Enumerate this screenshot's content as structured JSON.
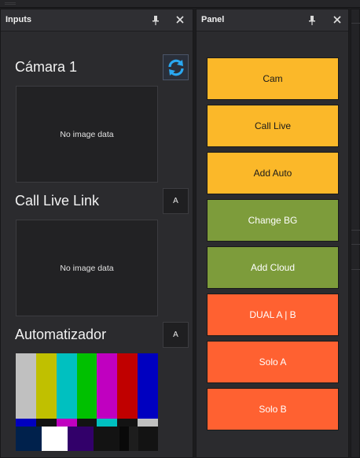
{
  "inputs_dock": {
    "title": "Inputs",
    "sections": [
      {
        "title": "Cámara 1",
        "preview_text": "No image data",
        "action": "refresh-icon"
      },
      {
        "title": "Call Live Link",
        "preview_text": "No image data",
        "action_label": "A"
      },
      {
        "title": "Automatizador",
        "action_label": "A"
      }
    ],
    "test_pattern_colors": {
      "top": [
        "#c0c0c0",
        "#c0c000",
        "#00c0c0",
        "#00c000",
        "#c000c0",
        "#c00000",
        "#0000c0"
      ],
      "middle": [
        "#0000c0",
        "#131313",
        "#c000c0",
        "#131313",
        "#00c0c0",
        "#131313",
        "#c0c0c0"
      ],
      "bottom": [
        "#00214c",
        "#ffffff",
        "#32006a",
        "#131313",
        "#090909",
        "#1d1d1d",
        "#131313"
      ]
    }
  },
  "panel_dock": {
    "title": "Panel",
    "buttons": [
      {
        "label": "Cam",
        "color": "#fbb829",
        "text_color": "#1a1a1a"
      },
      {
        "label": "Call Live",
        "color": "#fbb829",
        "text_color": "#1a1a1a"
      },
      {
        "label": "Add Auto",
        "color": "#fbb829",
        "text_color": "#1a1a1a"
      },
      {
        "label": "Change BG",
        "color": "#7d9c3b",
        "text_color": "#ffffff"
      },
      {
        "label": "Add Cloud",
        "color": "#7d9c3b",
        "text_color": "#ffffff"
      },
      {
        "label": "DUAL A | B",
        "color": "#ff6131",
        "text_color": "#ffffff"
      },
      {
        "label": "Solo A",
        "color": "#ff6131",
        "text_color": "#ffffff"
      },
      {
        "label": "Solo B",
        "color": "#ff6131",
        "text_color": "#ffffff"
      }
    ]
  },
  "icons": {
    "pin": "pin-icon",
    "close": "close-icon",
    "refresh": "refresh-icon"
  }
}
